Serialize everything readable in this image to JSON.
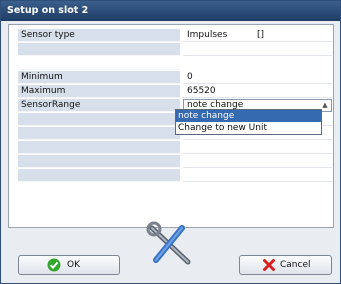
{
  "window": {
    "title": "Setup on slot 2"
  },
  "rows": [
    {
      "label": "Sensor type",
      "value": "Impulses",
      "extra": "[]"
    },
    {
      "label": "",
      "value": ""
    },
    {
      "label": "Minimum",
      "value": "0"
    },
    {
      "label": "Maximum",
      "value": "65520"
    },
    {
      "label": "SensorRange",
      "value": "note change"
    }
  ],
  "dropdown": {
    "options": [
      "note change",
      "Change to new Unit"
    ],
    "selected": "note change"
  },
  "buttons": {
    "ok_label": "OK",
    "cancel_label": "Cancel"
  },
  "icons": {
    "ok": "green-check-icon",
    "cancel": "red-x-icon",
    "tools": "wrench-screwdriver-icon"
  },
  "colors": {
    "title_bg": "#1e3d66",
    "label_bg": "#d7e0ea",
    "selection": "#3569b0"
  }
}
